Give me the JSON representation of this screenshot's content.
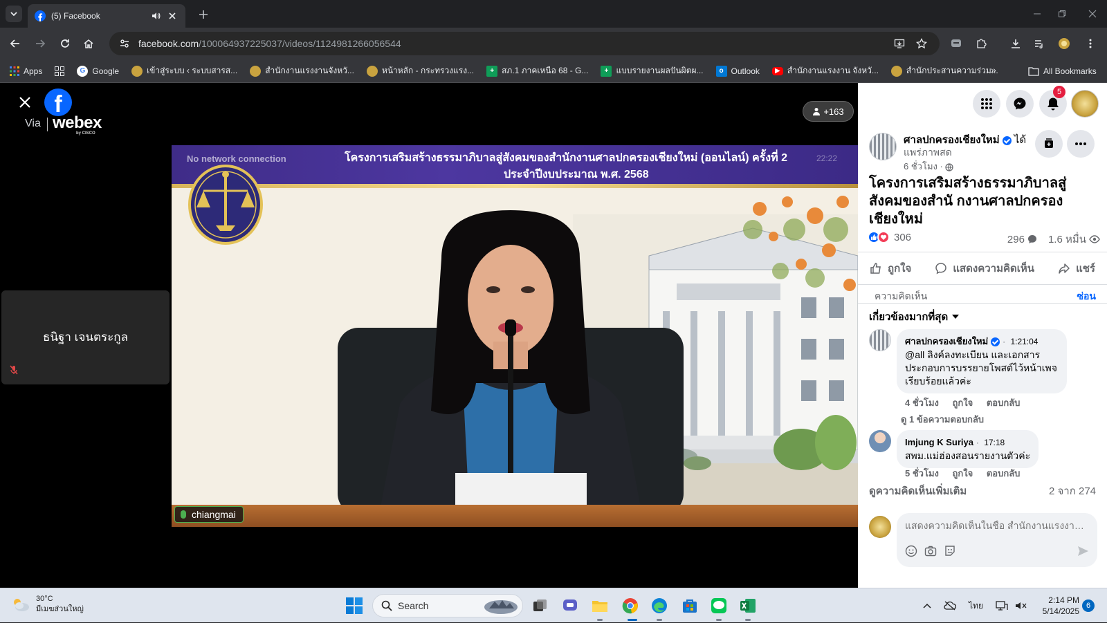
{
  "browser": {
    "tab_title": "(5) Facebook",
    "url_host": "facebook.com",
    "url_path": "/100064937225037/videos/1124981266056544",
    "bookmarks": [
      {
        "label": "Apps",
        "icon": "apps-grid-icon",
        "color": "#4285f4"
      },
      {
        "label": "Google",
        "icon": "google-icon",
        "color": "#ea4335"
      },
      {
        "label": "เข้าสู่ระบบ ‹ ระบบสารส...",
        "icon": "emblem-icon",
        "color": "#c9a33f"
      },
      {
        "label": "สำนักงานแรงงานจังหวั...",
        "icon": "emblem-icon",
        "color": "#c9a33f"
      },
      {
        "label": "หน้าหลัก - กระทรวงแรง...",
        "icon": "emblem-icon",
        "color": "#c9a33f"
      },
      {
        "label": "สภ.1 ภาคเหนือ 68 - G...",
        "icon": "sheets-icon",
        "color": "#0f9d58"
      },
      {
        "label": "แบบรายงานผลปันผิตผ...",
        "icon": "sheets-icon",
        "color": "#0f9d58"
      },
      {
        "label": "Outlook",
        "icon": "outlook-icon",
        "color": "#0078d4"
      },
      {
        "label": "สำนักงานแรงงาน จังหวั...",
        "icon": "youtube-icon",
        "color": "#ff0000"
      },
      {
        "label": "สำนักประสานความร่วม...",
        "icon": "emblem-icon",
        "color": "#c9a33f"
      }
    ],
    "all_bookmarks": "All Bookmarks",
    "overflow": "»"
  },
  "video": {
    "via": "Via",
    "webex": "webex",
    "by_cisco": "by CISCO",
    "participants": "+163",
    "side_tile_name": "ธนิฐา เจนตระกูล",
    "banner_line_1": "โครงการเสริมสร้างธรรมาภิบาลสู่สังคมของสำนักงานศาลปกครองเชียงใหม่ (ออนไลน์) ครั้งที่ 2",
    "banner_line_2": "ประจำปีงบประมาณ พ.ศ. 2568",
    "no_network": "No network connection",
    "stage_clock": "22:22",
    "stage_name": "chiangmai"
  },
  "post": {
    "notifications": "5",
    "page_name": "ศาลปกครองเชียงใหม่",
    "status_1": "ได้",
    "status_2": "แพร่ภาพสด",
    "time": "6 ชั่วโมง ·",
    "title": "โครงการเสริมสร้างธรรมาภิบาลสู่สังคมของสำนั กงานศาลปกครองเชียงใหม่",
    "reaction_count": "306",
    "comment_count": "296",
    "view_count": "1.6 หมื่น",
    "like_label": "ถูกใจ",
    "comment_label": "แสดงความคิดเห็น",
    "share_label": "แชร์",
    "comments_header": "ความคิดเห็น",
    "hide_label": "ซ่อน",
    "sort_label": "เกี่ยวข้องมากที่สุด",
    "comments": [
      {
        "author": "ศาลปกครองเชียงใหม่",
        "timestamp": "1:21:04",
        "text": "@all ลิงค์ลงทะเบียน และเอกสารประกอบการบรรยายโพสต์ไว้หน้าเพจเรียบร้อยแล้วค่ะ",
        "age": "4 ชั่วโมง",
        "like": "ถูกใจ",
        "reply": "ตอบกลับ",
        "view_replies": "ดู 1 ข้อความตอบกลับ"
      },
      {
        "author": "Imjung K Suriya",
        "timestamp": "17:18",
        "text": "สพม.แม่ฮ่องสอนรายงานตัวค่ะ",
        "age": "5 ชั่วโมง",
        "like": "ถูกใจ",
        "reply": "ตอบกลับ"
      }
    ],
    "more_comments": "ดูความคิดเห็นเพิ่มเติม",
    "pagination": "2 จาก 274",
    "composer_placeholder": "แสดงความคิดเห็นในชื่อ สำนักงานแรงงาน..."
  },
  "taskbar": {
    "temperature": "30°C",
    "weather_desc": "มีเมฆส่วนใหญ่",
    "search_placeholder": "Search",
    "language": "ไทย",
    "time": "2:14 PM",
    "date": "5/14/2025",
    "notification_count": "6"
  }
}
